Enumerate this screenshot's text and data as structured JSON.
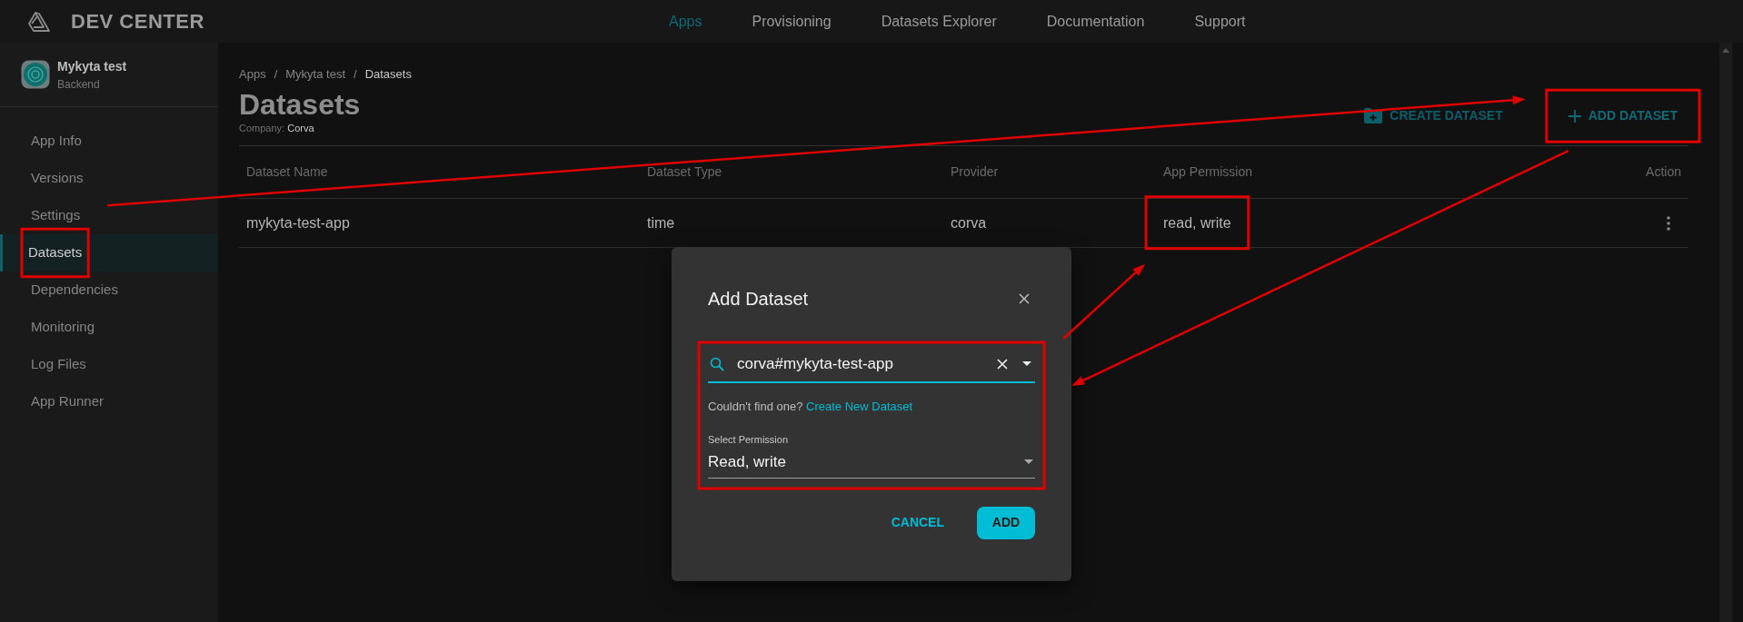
{
  "header": {
    "logo_text": "DEV CENTER",
    "nav": [
      {
        "label": "Apps",
        "selected": true
      },
      {
        "label": "Provisioning",
        "selected": false
      },
      {
        "label": "Datasets Explorer",
        "selected": false
      },
      {
        "label": "Documentation",
        "selected": false
      },
      {
        "label": "Support",
        "selected": false
      }
    ]
  },
  "sidebar": {
    "app": {
      "name": "Mykyta test",
      "subtitle": "Backend"
    },
    "items": [
      {
        "label": "App Info",
        "selected": false,
        "highlighted": false
      },
      {
        "label": "Versions",
        "selected": false,
        "highlighted": false
      },
      {
        "label": "Settings",
        "selected": false,
        "highlighted": false
      },
      {
        "label": "Datasets",
        "selected": true,
        "highlighted": true
      },
      {
        "label": "Dependencies",
        "selected": false,
        "highlighted": false
      },
      {
        "label": "Monitoring",
        "selected": false,
        "highlighted": false
      },
      {
        "label": "Log Files",
        "selected": false,
        "highlighted": false
      },
      {
        "label": "App Runner",
        "selected": false,
        "highlighted": false
      }
    ]
  },
  "page": {
    "breadcrumb": [
      {
        "label": "Apps",
        "separator": "/"
      },
      {
        "label": "Mykyta test",
        "separator": "/"
      },
      {
        "label": "Datasets"
      }
    ],
    "title": "Datasets",
    "company_label": "Company:",
    "company": "Corva",
    "actions": [
      {
        "kind": "create",
        "label": "CREATE DATASET",
        "highlighted": false
      },
      {
        "kind": "add",
        "label": "ADD DATASET",
        "highlighted": true
      }
    ]
  },
  "table": {
    "columns": [
      "Dataset Name",
      "Dataset Type",
      "Provider",
      "App Permission",
      "Action"
    ],
    "rows": [
      {
        "cells": [
          {
            "text": "mykyta-test-app",
            "highlighted": false
          },
          {
            "text": "time",
            "highlighted": false
          },
          {
            "text": "corva",
            "highlighted": false
          },
          {
            "text": "read, write",
            "highlighted": true
          }
        ]
      }
    ]
  },
  "dialog": {
    "title": "Add Dataset",
    "search": {
      "value": "corva#mykyta-test-app",
      "focused": true
    },
    "helper": "Couldn't find one?",
    "helper_link": "Create New Dataset",
    "permission": {
      "label": "Select Permission",
      "value": "Read, write"
    },
    "fields_highlighted": true,
    "buttons": [
      {
        "kind": "text",
        "label": "CANCEL"
      },
      {
        "kind": "contained",
        "label": "ADD"
      }
    ]
  }
}
